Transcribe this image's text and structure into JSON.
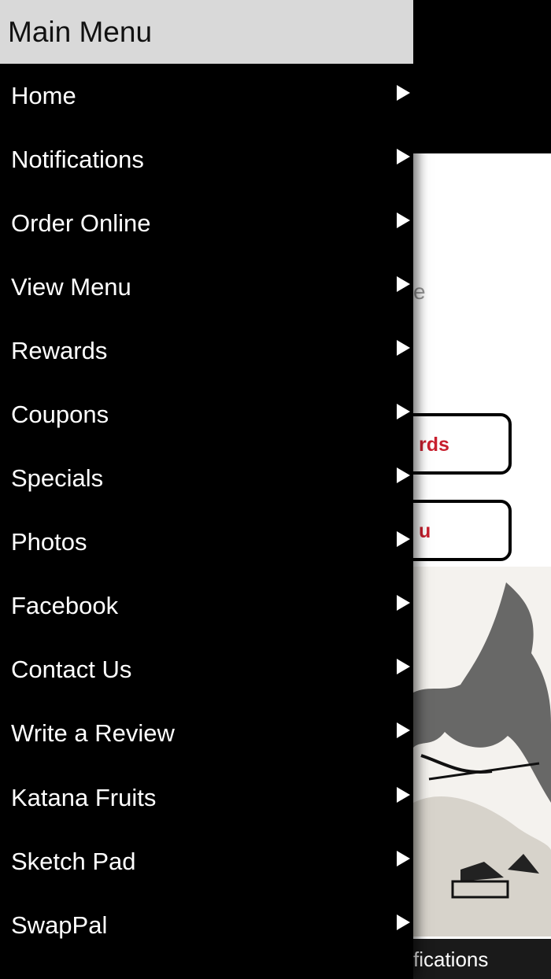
{
  "drawer": {
    "title": "Main Menu",
    "items": [
      {
        "label": "Home"
      },
      {
        "label": "Notifications"
      },
      {
        "label": "Order Online"
      },
      {
        "label": "View Menu"
      },
      {
        "label": "Rewards"
      },
      {
        "label": "Coupons"
      },
      {
        "label": "Specials"
      },
      {
        "label": "Photos"
      },
      {
        "label": "Facebook"
      },
      {
        "label": "Contact Us"
      },
      {
        "label": "Write a Review"
      },
      {
        "label": "Katana Fruits"
      },
      {
        "label": "Sketch Pad"
      },
      {
        "label": "SwapPal"
      }
    ]
  },
  "background": {
    "faint_text": "e",
    "rewards_button_partial": "rds",
    "menu_button_partial": "u",
    "bottom_bar_partial": "fications",
    "accent_color": "#d21f30"
  }
}
